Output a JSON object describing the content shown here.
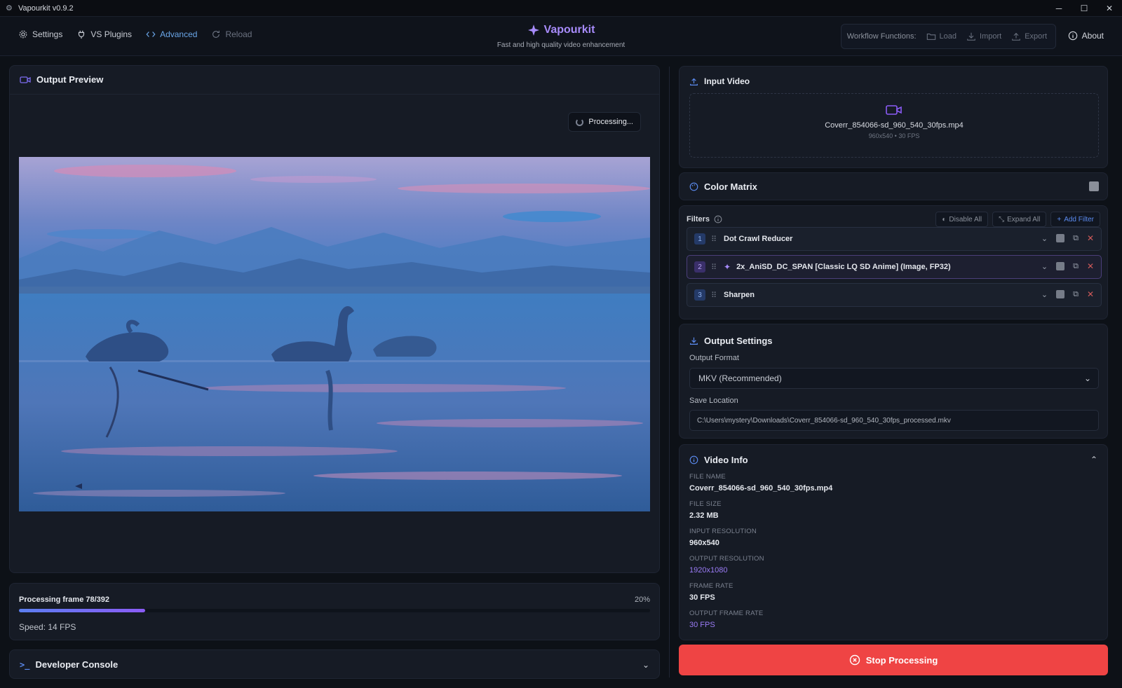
{
  "window": {
    "title": "Vapourkit v0.9.2",
    "controls": [
      "minimize",
      "maximize",
      "close"
    ]
  },
  "nav": {
    "settings": "Settings",
    "vs_plugins": "VS Plugins",
    "advanced": "Advanced",
    "reload": "Reload"
  },
  "brand": {
    "title": "Vapourkit",
    "subtitle": "Fast and high quality video enhancement",
    "accent": "#a78bfa"
  },
  "workflow": {
    "label": "Workflow Functions:",
    "load": "Load",
    "import": "Import",
    "export": "Export"
  },
  "about": "About",
  "preview": {
    "title": "Output Preview",
    "status": "Processing..."
  },
  "progress": {
    "text": "Processing frame 78/392",
    "percent_label": "20%",
    "fraction": 0.2,
    "speed": "Speed: 14 FPS"
  },
  "console": {
    "title": "Developer Console"
  },
  "input_video": {
    "title": "Input Video",
    "file_name": "Coverr_854066-sd_960_540_30fps.mp4",
    "meta": "960x540 • 30 FPS"
  },
  "color_matrix": {
    "title": "Color Matrix"
  },
  "filters": {
    "label": "Filters",
    "disable_all": "Disable All",
    "expand_all": "Expand All",
    "add_filter": "Add Filter",
    "items": [
      {
        "num": "1",
        "name": "Dot Crawl Reducer"
      },
      {
        "num": "2",
        "name": "2x_AniSD_DC_SPAN [Classic LQ SD Anime] (Image, FP32)"
      },
      {
        "num": "3",
        "name": "Sharpen"
      }
    ]
  },
  "output_settings": {
    "title": "Output Settings",
    "format_label": "Output Format",
    "format_value": "MKV (Recommended)",
    "save_label": "Save Location",
    "save_value": "C:\\Users\\mystery\\Downloads\\Coverr_854066-sd_960_540_30fps_processed.mkv"
  },
  "video_info": {
    "title": "Video Info",
    "items": [
      {
        "key": "FILE NAME",
        "value": "Coverr_854066-sd_960_540_30fps.mp4"
      },
      {
        "key": "FILE SIZE",
        "value": "2.32 MB"
      },
      {
        "key": "INPUT RESOLUTION",
        "value": "960x540"
      },
      {
        "key": "OUTPUT RESOLUTION",
        "value": "1920x1080"
      },
      {
        "key": "FRAME RATE",
        "value": "30 FPS"
      },
      {
        "key": "OUTPUT FRAME RATE",
        "value": "30 FPS"
      }
    ]
  },
  "stop_button": "Stop Processing",
  "colors": {
    "danger": "#ef4444",
    "accent_blue": "#6aa6e8",
    "accent_purple": "#9a7bf5"
  }
}
